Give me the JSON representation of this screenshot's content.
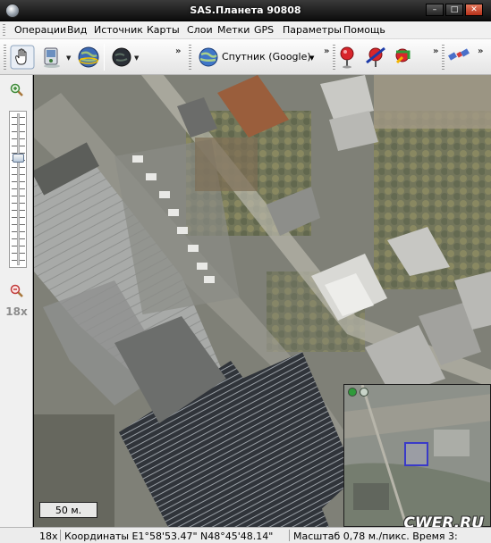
{
  "window": {
    "title": "SAS.Планета 90808",
    "controls": [
      "minimize",
      "maximize",
      "close"
    ]
  },
  "menu": {
    "items": [
      "Операции",
      "Вид",
      "Источник",
      "Карты",
      "Слои",
      "Метки",
      "GPS",
      "Параметры",
      "Помощь"
    ]
  },
  "toolbar": {
    "icons": [
      "hand-icon",
      "gps-device-icon",
      "globe-icon",
      "dark-globe-icon",
      "red-marker-icon",
      "red-marker-delete-icon",
      "marker-edit-icon",
      "satellite-icon"
    ],
    "source_label": "Спутник (Google)",
    "overflow_glyph": "»"
  },
  "zoom": {
    "level_label": "18x",
    "level_fraction": 0.28
  },
  "map": {
    "scale_label": "50 м.",
    "watermark": "CWER.RU"
  },
  "status": {
    "zoom": "18x",
    "coordinates": "Координаты E1°58'53.47\" N48°45'48.14\"",
    "scale": "Масштаб 0,78 м./пикс. Время 3:"
  },
  "colors": {
    "title_bar": "#1a1a1a",
    "menu_bg": "#f0f0f0",
    "minimap_view_box": "#3a3ac8"
  }
}
